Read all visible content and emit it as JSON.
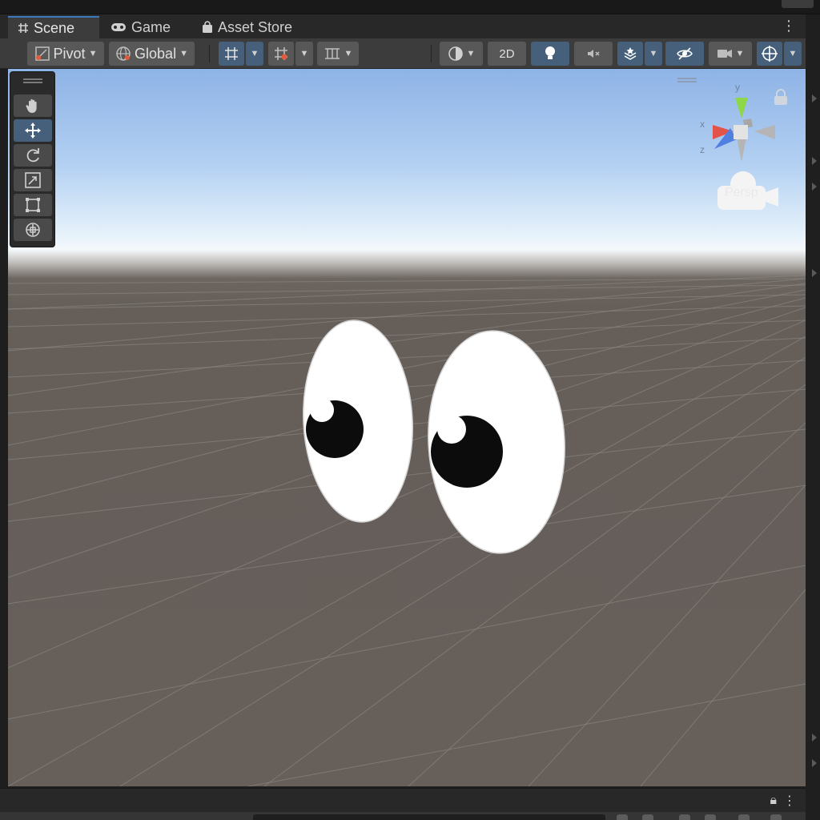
{
  "tabs": [
    {
      "label": "Scene",
      "icon": "grid-hash-icon",
      "active": true
    },
    {
      "label": "Game",
      "icon": "gamepad-icon",
      "active": false
    },
    {
      "label": "Asset Store",
      "icon": "shopping-bag-icon",
      "active": false
    }
  ],
  "toolbar": {
    "pivot_label": "Pivot",
    "global_label": "Global",
    "mode_2d_label": "2D",
    "icons": [
      "pivot-icon",
      "global-icon",
      "grid-snap-icon",
      "increment-snap-icon",
      "ruler-icon",
      "shading-mode-icon",
      "light-bulb-icon",
      "audio-mute-icon",
      "effects-icon",
      "hidden-objects-icon",
      "scene-camera-icon",
      "gizmos-icon"
    ]
  },
  "tools": [
    "hand-tool-icon",
    "move-tool-icon",
    "rotate-tool-icon",
    "scale-tool-icon",
    "rect-tool-icon",
    "transform-tool-icon"
  ],
  "active_tool": "move-tool-icon",
  "gizmo": {
    "y": "y",
    "x": "x",
    "z": "z",
    "projection": "Persp"
  },
  "scene": {
    "object": "googly-eyes"
  },
  "colors": {
    "accent": "#3a79bb",
    "active_button": "#46607c",
    "sky_top": "#8eb3e6",
    "ground": "#665f5a",
    "axis_x": "#e2544a",
    "axis_y": "#8ed64a",
    "axis_z": "#4f7fe0"
  }
}
